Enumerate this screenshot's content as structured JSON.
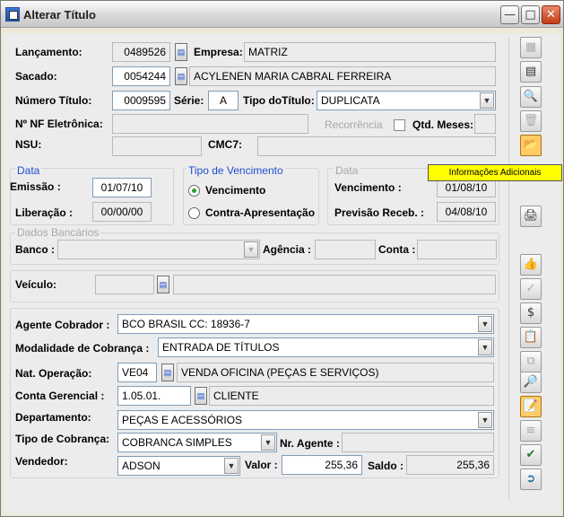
{
  "window": {
    "title": "Alterar Título"
  },
  "labels": {
    "lancamento": "Lançamento:",
    "empresa": "Empresa:",
    "sacado": "Sacado:",
    "numero_titulo": "Número Título:",
    "serie": "Série:",
    "tipo_titulo": "Tipo doTítulo:",
    "nf": "Nº NF Eletrônica:",
    "recorrencia": "Recorrência",
    "qtd_meses": "Qtd. Meses:",
    "nsu": "NSU:",
    "cmc7": "CMC7:",
    "data_grp": "Data",
    "emissao": "Emissão :",
    "liberacao": "Liberação :",
    "tipo_venc_grp": "Tipo de Vencimento",
    "vencimento_opt": "Vencimento",
    "contra_opt": "Contra-Apresentação",
    "data2_grp": "Data",
    "vencimento": "Vencimento :",
    "previsao": "Previsão Receb. :",
    "dados_bancarios": "Dados Bancários",
    "banco": "Banco :",
    "agencia": "Agência :",
    "conta": "Conta :",
    "veiculo": "Veículo:",
    "agente": "Agente Cobrador :",
    "modalidade": "Modalidade de Cobrança :",
    "nat_op": "Nat. Operação:",
    "conta_ger": "Conta Gerencial :",
    "departamento": "Departamento:",
    "tipo_cobranca": "Tipo de Cobrança:",
    "nr_agente": "Nr. Agente :",
    "vendedor": "Vendedor:",
    "valor": "Valor :",
    "saldo": "Saldo :"
  },
  "values": {
    "lancamento": "0489526",
    "empresa": "MATRIZ",
    "sacado_code": "0054244",
    "sacado_name": "ACYLENEN MARIA CABRAL FERREIRA",
    "numero_titulo": "0009595",
    "serie": "A",
    "tipo_titulo": "DUPLICATA",
    "emissao": "01/07/10",
    "liberacao": "00/00/00",
    "vencimento": "01/08/10",
    "previsao": "04/08/10",
    "agente": "BCO BRASIL CC: 18936-7",
    "modalidade": "ENTRADA DE TÍTULOS",
    "nat_op_code": "VE04",
    "nat_op_desc": "VENDA OFICINA (PEÇAS E SERVIÇOS)",
    "conta_ger_code": "1.05.01.",
    "conta_ger_desc": "CLIENTE",
    "departamento": "PEÇAS E ACESSÓRIOS",
    "tipo_cobranca": "COBRANCA SIMPLES",
    "vendedor": "ADSON",
    "valor": "255,36",
    "saldo": "255,36"
  },
  "tooltip": "Informações Adicionais",
  "sidebar_icons": [
    "insert-row-icon",
    "edit-row-icon",
    "preview-icon",
    "delete-icon",
    "open-folder-icon",
    "print-icon",
    "thumbs-up-icon",
    "check-icon",
    "money-bag-icon",
    "clipboard-icon",
    "copy-icon",
    "search-doc-icon",
    "calculator-icon",
    "list-search-icon",
    "excel-icon",
    "exit-door-icon"
  ]
}
